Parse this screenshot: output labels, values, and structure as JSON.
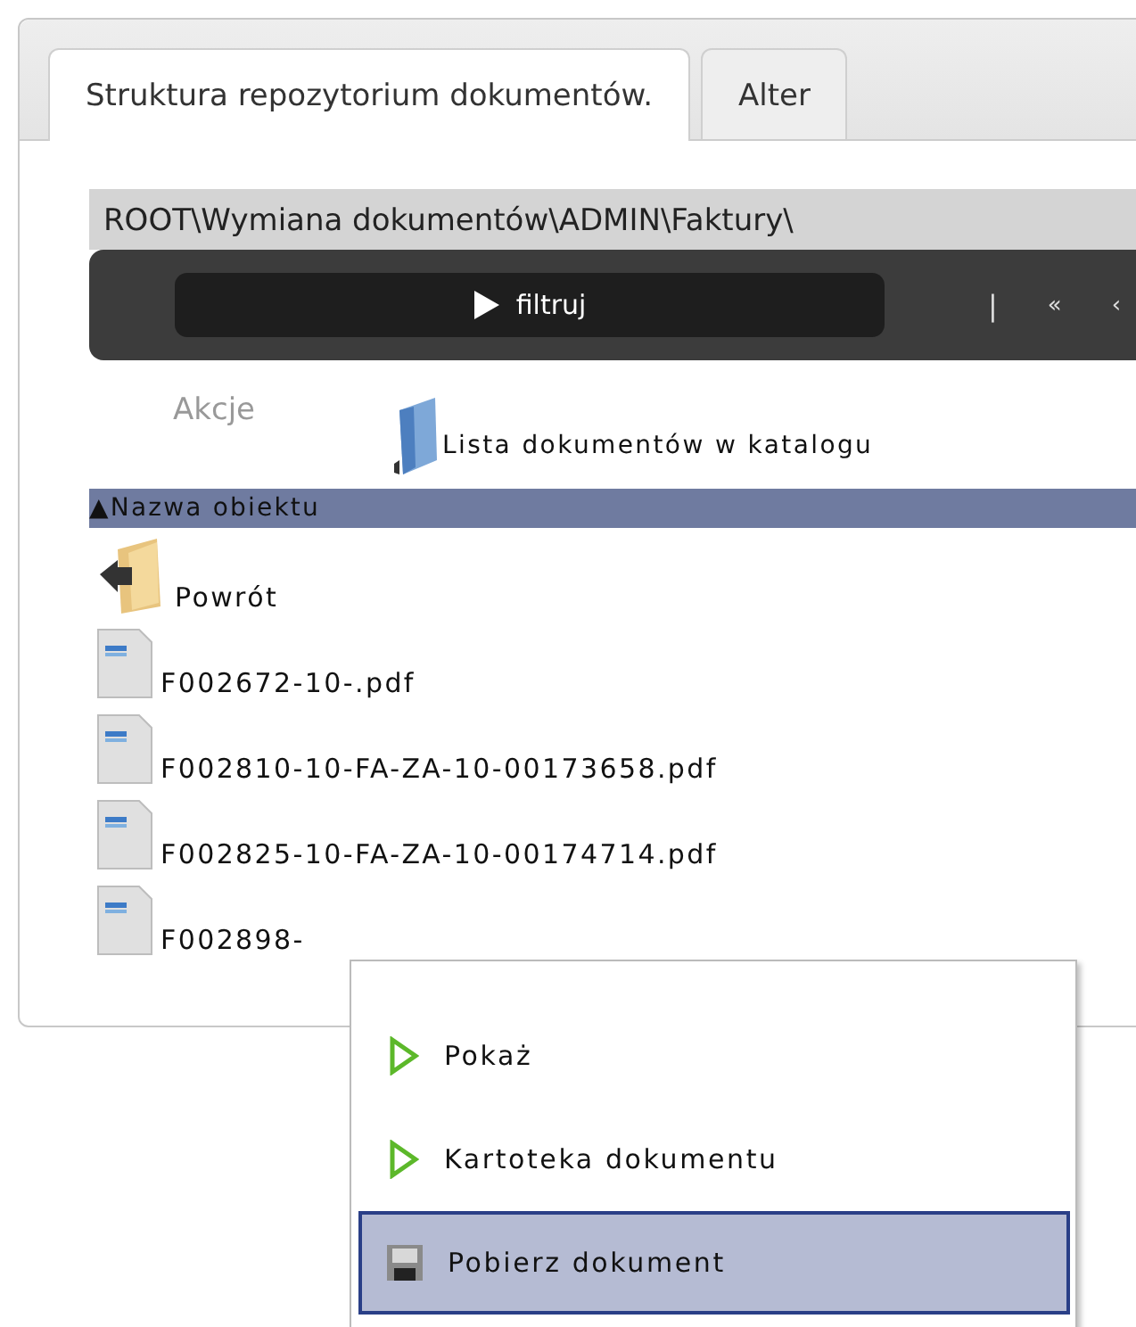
{
  "tabs": [
    {
      "label": "Struktura repozytorium dokumentów.",
      "selected": true
    },
    {
      "label": "Alter",
      "selected": false
    }
  ],
  "breadcrumb": "ROOT\\Wymiana dokumentów\\ADMIN\\Faktury\\",
  "toolbar": {
    "filter_button": "filtruj",
    "separator": "|",
    "pager": [
      "«",
      "‹"
    ]
  },
  "actions": {
    "label": "Akcje",
    "list_title": "Lista dokumentów w katalogu"
  },
  "table": {
    "column": "Nazwa obiektu",
    "sort_mark": "▲",
    "rows": [
      {
        "kind": "back",
        "name": "Powrót"
      },
      {
        "kind": "file",
        "name": "F002672-10-.pdf"
      },
      {
        "kind": "file",
        "name": "F002810-10-FA-ZA-10-00173658.pdf"
      },
      {
        "kind": "file",
        "name": "F002825-10-FA-ZA-10-00174714.pdf"
      },
      {
        "kind": "file",
        "name": "F002898-"
      }
    ]
  },
  "context_menu": [
    {
      "kind": "play",
      "label": "Pokaż",
      "selected": false
    },
    {
      "kind": "play",
      "label": "Kartoteka dokumentu",
      "selected": false
    },
    {
      "kind": "save",
      "label": "Pobierz dokument",
      "selected": true
    }
  ]
}
